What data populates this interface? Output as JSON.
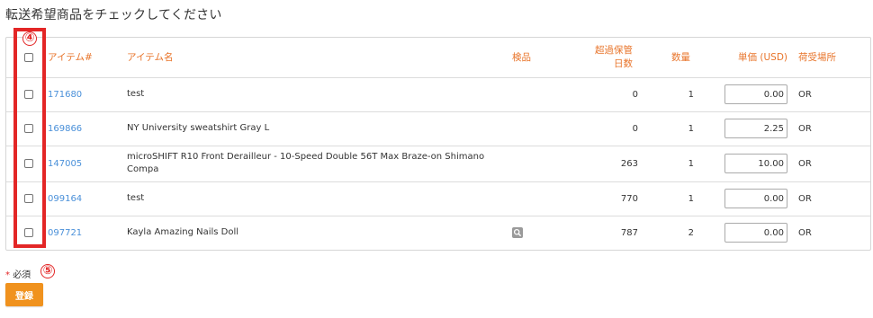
{
  "page_title": "転送希望商品をチェックしてください",
  "table": {
    "headers": {
      "item_no": "アイテム#",
      "item_name": "アイテム名",
      "inspection": "検品",
      "overdue_days_line1": "超過保管",
      "overdue_days_line2": "日数",
      "quantity": "数量",
      "unit_price": "単価 (USD)",
      "location": "荷受場所"
    },
    "rows": [
      {
        "id": "171680",
        "name": "test",
        "has_inspection": false,
        "days": "0",
        "qty": "1",
        "price": "0.00",
        "location": "OR"
      },
      {
        "id": "169866",
        "name": "NY University sweatshirt Gray L",
        "has_inspection": false,
        "days": "0",
        "qty": "1",
        "price": "2.25",
        "location": "OR"
      },
      {
        "id": "147005",
        "name": "microSHIFT R10 Front Derailleur - 10-Speed Double 56T Max Braze-on Shimano Compa",
        "has_inspection": false,
        "days": "263",
        "qty": "1",
        "price": "10.00",
        "location": "OR"
      },
      {
        "id": "099164",
        "name": "test",
        "has_inspection": false,
        "days": "770",
        "qty": "1",
        "price": "0.00",
        "location": "OR"
      },
      {
        "id": "097721",
        "name": "Kayla Amazing Nails Doll",
        "has_inspection": true,
        "days": "787",
        "qty": "2",
        "price": "0.00",
        "location": "OR"
      }
    ]
  },
  "annotations": {
    "circle4": "④",
    "circle5": "⑤"
  },
  "required_note": {
    "star": "*",
    "label": "必須"
  },
  "submit_label": "登録",
  "colors": {
    "accent": "#e8742a",
    "link": "#4a90d9",
    "highlight": "#e32626",
    "button": "#f0921e"
  }
}
